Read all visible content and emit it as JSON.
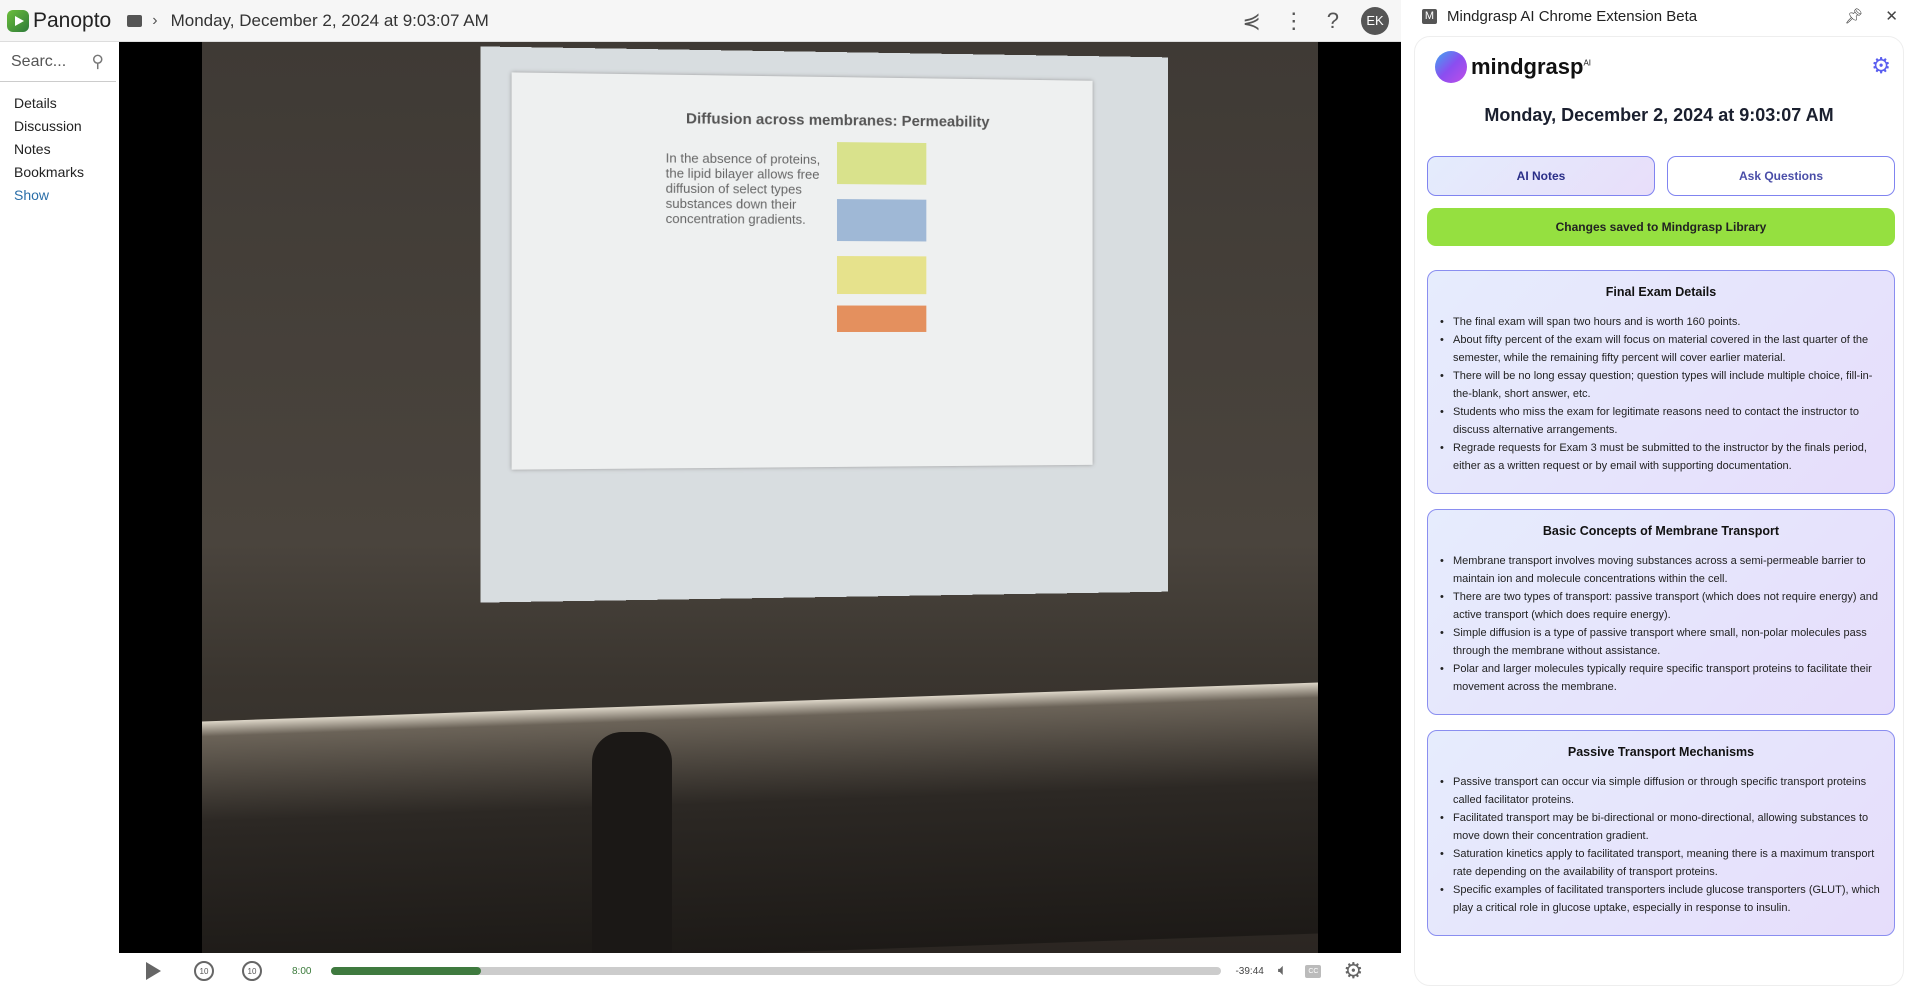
{
  "topbar": {
    "brand": "Panopto",
    "title": "Monday, December 2, 2024 at 9:03:07 AM",
    "avatar": "EK",
    "icons": [
      "share-icon",
      "more-vertical-icon",
      "help-icon"
    ]
  },
  "sidebar": {
    "search_placeholder": "Searc...",
    "items": [
      "Details",
      "Discussion",
      "Notes",
      "Bookmarks"
    ],
    "show": "Show"
  },
  "video": {
    "slide_title": "Diffusion across membranes: Permeability",
    "slide_text": "In the absence of proteins, the lipid bilayer allows free diffusion of select types substances down their concentration gradients."
  },
  "player": {
    "current_time": "8:00",
    "remaining": "-39:44",
    "progress_percent": 16.8,
    "skip_back": "10",
    "skip_forward": "10",
    "cc": "CC"
  },
  "extension": {
    "title": "Mindgrasp AI Chrome Extension Beta",
    "badge": "M",
    "brand": "mindgrasp",
    "brand_sup": "AI",
    "date": "Monday, December 2, 2024 at 9:03:07 AM",
    "tabs": [
      {
        "label": "AI Notes",
        "active": true
      },
      {
        "label": "Ask Questions",
        "active": false
      }
    ],
    "status": "Changes saved to Mindgrasp Library",
    "accent": "#8a8ef0",
    "status_color": "#95e040",
    "cards": [
      {
        "title": "Final Exam Details",
        "items": [
          "The final exam will span two hours and is worth 160 points.",
          "About fifty percent of the exam will focus on material covered in the last quarter of the semester, while the remaining fifty percent will cover earlier material.",
          "There will be no long essay question; question types will include multiple choice, fill-in-the-blank, short answer, etc.",
          "Students who miss the exam for legitimate reasons need to contact the instructor to discuss alternative arrangements.",
          "Regrade requests for Exam 3 must be submitted to the instructor by the finals period, either as a written request or by email with supporting documentation."
        ]
      },
      {
        "title": "Basic Concepts of Membrane Transport",
        "items": [
          "Membrane transport involves moving substances across a semi-permeable barrier to maintain ion and molecule concentrations within the cell.",
          "There are two types of transport: passive transport (which does not require energy) and active transport (which does require energy).",
          "Simple diffusion is a type of passive transport where small, non-polar molecules pass through the membrane without assistance.",
          "Polar and larger molecules typically require specific transport proteins to facilitate their movement across the membrane."
        ]
      },
      {
        "title": "Passive Transport Mechanisms",
        "items": [
          "Passive transport can occur via simple diffusion or through specific transport proteins called facilitator proteins.",
          "Facilitated transport may be bi-directional or mono-directional, allowing substances to move down their concentration gradient.",
          "Saturation kinetics apply to facilitated transport, meaning there is a maximum transport rate depending on the availability of transport proteins.",
          "Specific examples of facilitated transporters include glucose transporters (GLUT), which play a critical role in glucose uptake, especially in response to insulin."
        ]
      }
    ]
  }
}
